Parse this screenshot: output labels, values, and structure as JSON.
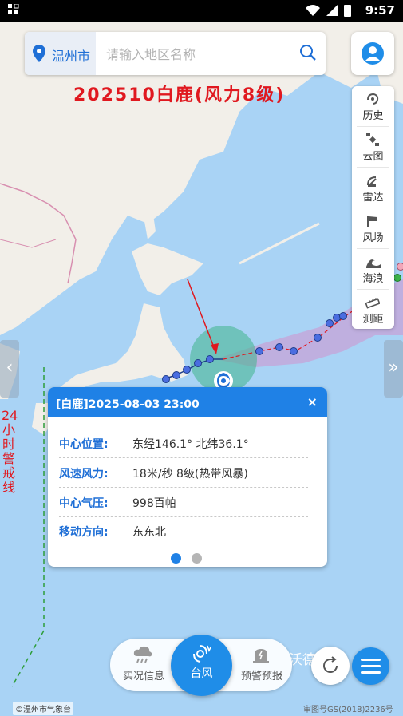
{
  "status_bar": {
    "time": "9:57",
    "battery": "8"
  },
  "search": {
    "city": "温州市",
    "placeholder": "请输入地区名称"
  },
  "typhoon": {
    "title": "202510白鹿(风力8级)"
  },
  "toolbar": {
    "items": [
      {
        "label": "历史",
        "icon": "history-icon"
      },
      {
        "label": "云图",
        "icon": "satellite-icon"
      },
      {
        "label": "雷达",
        "icon": "radar-icon"
      },
      {
        "label": "风场",
        "icon": "wind-field-icon"
      },
      {
        "label": "海浪",
        "icon": "wave-icon"
      },
      {
        "label": "测距",
        "icon": "ruler-icon"
      }
    ]
  },
  "warning_line": {
    "label": "24小时警戒线"
  },
  "popup": {
    "title": "[白鹿]2025-08-03 23:00",
    "close": "×",
    "rows": [
      {
        "key": "中心位置:",
        "value": "东经146.1° 北纬36.1°"
      },
      {
        "key": "风速风力:",
        "value": "18米/秒 8级(热带风暴)"
      },
      {
        "key": "中心气压:",
        "value": "998百帕"
      },
      {
        "key": "移动方向:",
        "value": "东东北"
      }
    ],
    "page_active": 0,
    "page_count": 2
  },
  "bottom_nav": {
    "left": {
      "label": "实况信息",
      "icon": "cloud-rain-icon"
    },
    "center": {
      "label": "台风",
      "icon": "typhoon-icon"
    },
    "right": {
      "label": "预警预报",
      "icon": "alarm-icon"
    }
  },
  "watermark": "沃德 站",
  "credit": "©温州市气象台",
  "map_number": "审图号GS(2018)2236号",
  "colors": {
    "accent": "#1f81e6",
    "title_red": "#e0181f",
    "sea": "#a9d3f5",
    "land": "#f2efe9"
  }
}
